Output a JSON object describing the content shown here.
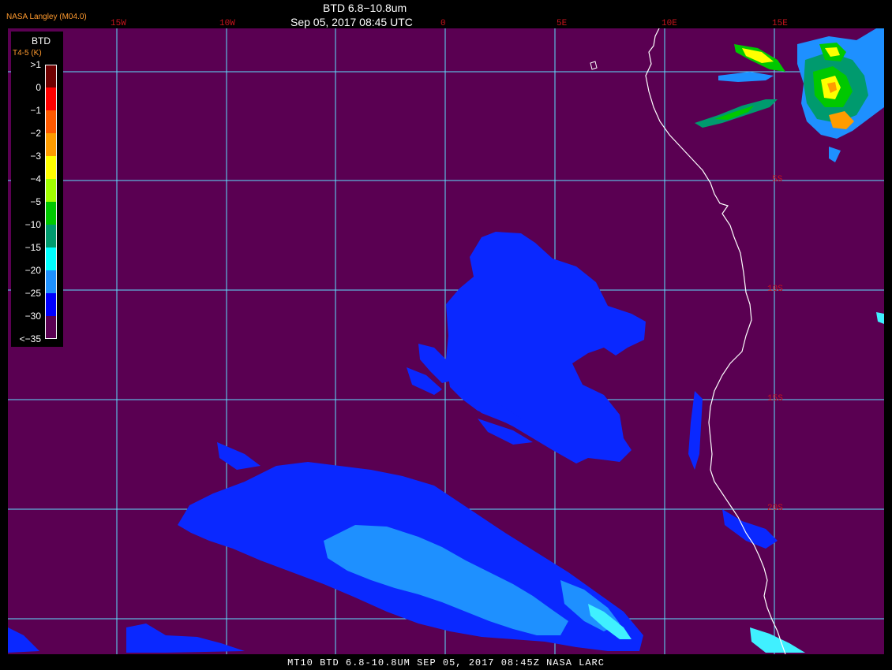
{
  "header": {
    "org": "NASA Langley (M04.0)",
    "title": "BTD 6.8−10.8um",
    "datetime": "Sep 05, 2017 08:45 UTC"
  },
  "footer": "MT10  BTD 6.8-10.8UM   SEP 05, 2017 08:45Z   NASA LARC",
  "legend": {
    "title": "BTD",
    "units": "T4-5 (K)",
    "ticks": [
      ">1",
      "0",
      "−1",
      "−2",
      "−3",
      "−4",
      "−5",
      "−10",
      "−15",
      "−20",
      "−25",
      "−30",
      "<−35"
    ],
    "colors": [
      "#6e0000",
      "#ff0000",
      "#ff5a00",
      "#ff9c00",
      "#ffff00",
      "#a0ff00",
      "#00c800",
      "#009a6e",
      "#00ffff",
      "#1e90ff",
      "#0000ff",
      "#5a0052"
    ]
  },
  "grid": {
    "lon_labels": [
      "15W",
      "10W",
      "0",
      "5E",
      "10E",
      "15E"
    ],
    "lat_labels": [
      "5S",
      "10S",
      "15S",
      "20S"
    ]
  },
  "colors": {
    "background": "#5a0052",
    "grid": "#5fe0ff",
    "coast": "#ffffff",
    "cloud_blue": "#0a28ff",
    "cloud_light_blue": "#1e90ff",
    "cloud_cyan": "#40f0ff"
  }
}
